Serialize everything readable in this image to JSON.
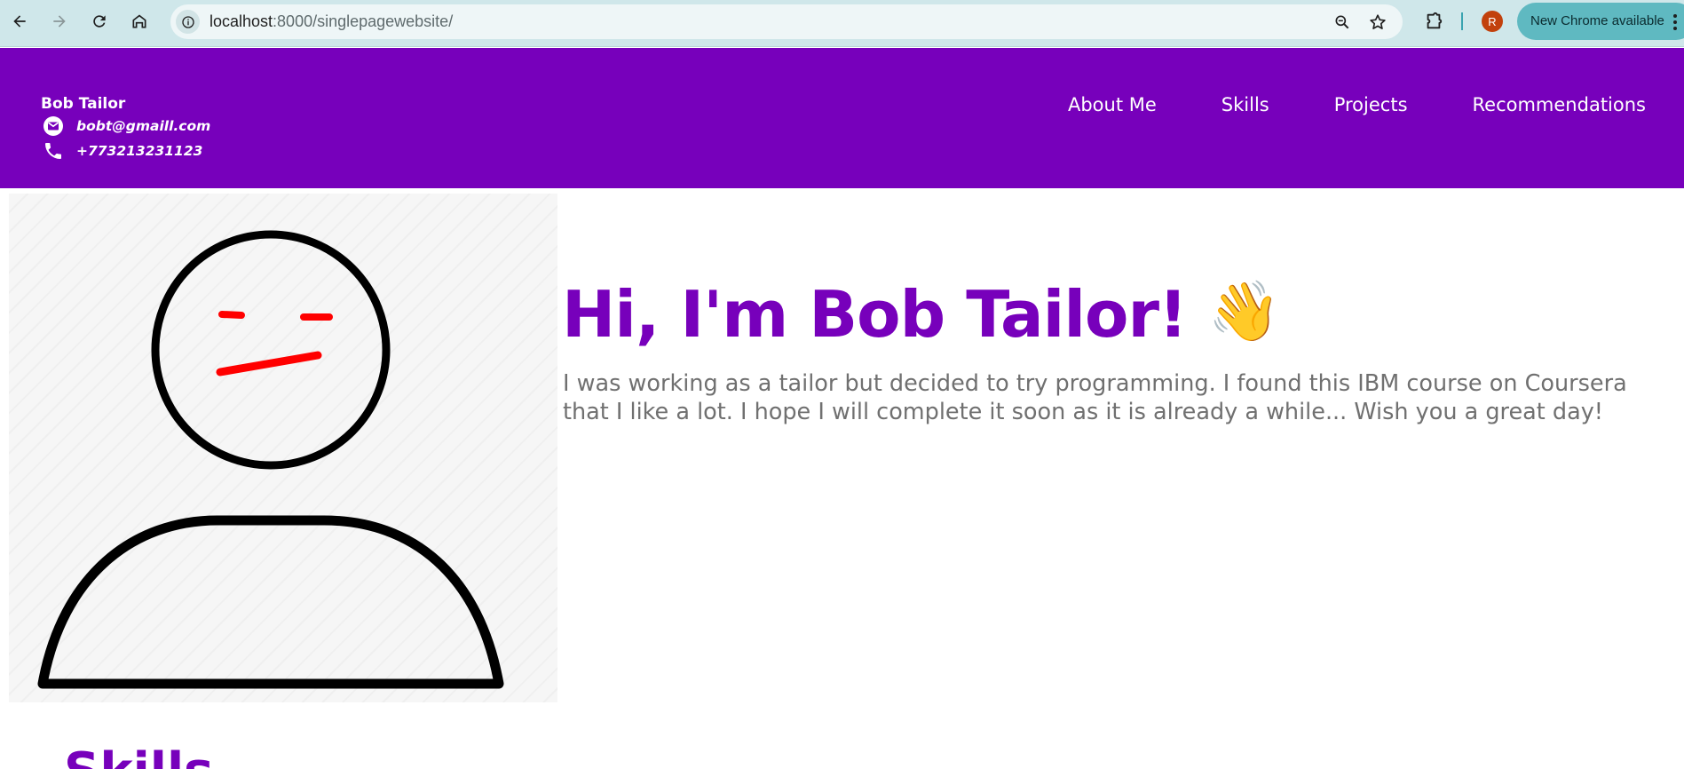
{
  "browser": {
    "url_host": "localhost",
    "url_rest": ":8000/singlepagewebsite/",
    "avatar_letter": "R",
    "update_label": "New Chrome available"
  },
  "header": {
    "name": "Bob Tailor",
    "email": "bobt@gmaill.com",
    "phone": "+773213231123",
    "nav": [
      "About Me",
      "Skills",
      "Projects",
      "Recommendations"
    ]
  },
  "hero": {
    "title": "Hi, I'm Bob Tailor!",
    "emoji": "👋",
    "text": "I was working as a tailor but decided to try programming. I found this IBM course on Coursera that I like a lot. I hope I will complete it soon as it is already a while... Wish you a great day!"
  },
  "skills": {
    "title": "Skills"
  },
  "colors": {
    "brand": "#7700bb",
    "chrome": "#cfe7ea"
  }
}
